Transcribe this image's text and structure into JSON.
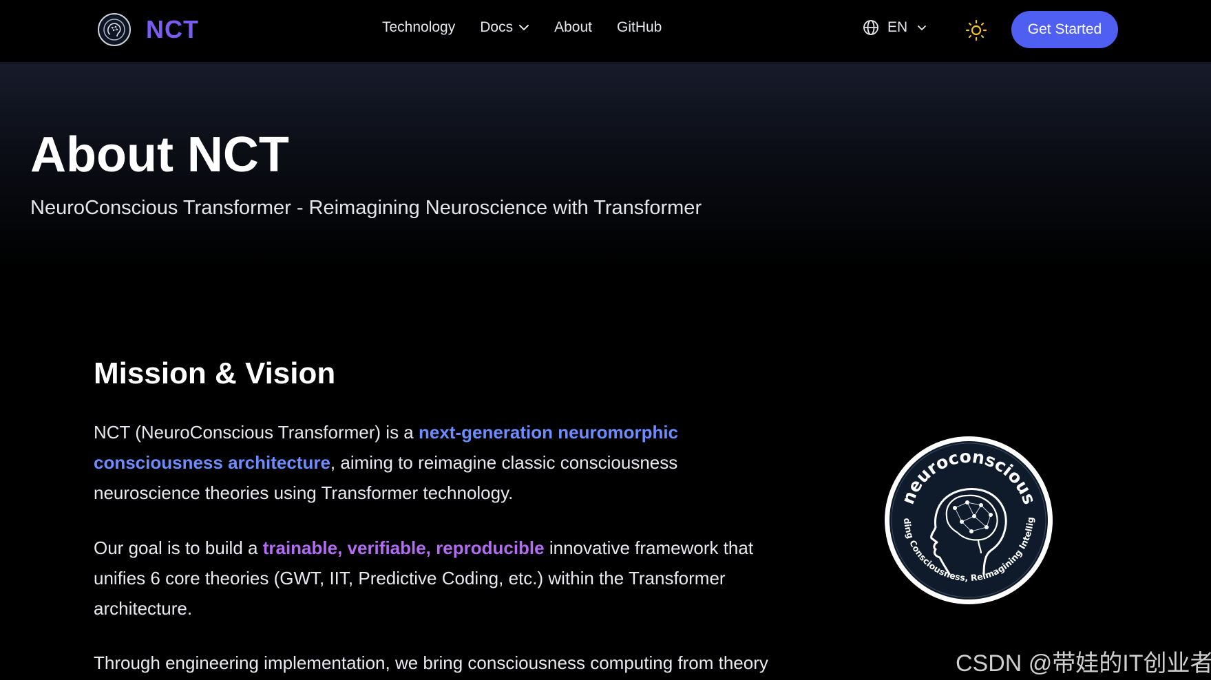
{
  "header": {
    "brand": "NCT",
    "nav": [
      {
        "label": "Technology"
      },
      {
        "label": "Docs",
        "has_dropdown": true
      },
      {
        "label": "About"
      },
      {
        "label": "GitHub"
      }
    ],
    "language": {
      "code": "EN",
      "icon": "globe-icon"
    },
    "theme_icon": "sun-icon",
    "cta_label": "Get Started"
  },
  "hero": {
    "title": "About NCT",
    "subtitle": "NeuroConscious Transformer - Reimagining Neuroscience with Transformer"
  },
  "mission": {
    "title": "Mission & Vision",
    "p1": {
      "before": "NCT (NeuroConscious Transformer) is a ",
      "highlight": "next-generation neuromorphic consciousness architecture",
      "after": ", aiming to reimagine classic consciousness neuroscience theories using Transformer technology."
    },
    "p2": {
      "before": "Our goal is to build a ",
      "highlight": "trainable, verifiable, reproducible",
      "after": " innovative framework that unifies 6 core theories (GWT, IIT, Predictive Coding, etc.) within the Transformer architecture."
    },
    "p3": "Through engineering implementation, we bring consciousness computing from theory"
  },
  "badge": {
    "top_text": "neuroconscious",
    "bottom_text": "Decoding Consciousness, Reimagining Intelligence"
  },
  "watermark": "CSDN @带娃的IT创业者",
  "colors": {
    "brand": "#7c5cf0",
    "cta": "#4f5ff2",
    "highlight_blue": "#6c8cff",
    "highlight_purple": "#b36cf3",
    "sun": "#f5c518"
  }
}
